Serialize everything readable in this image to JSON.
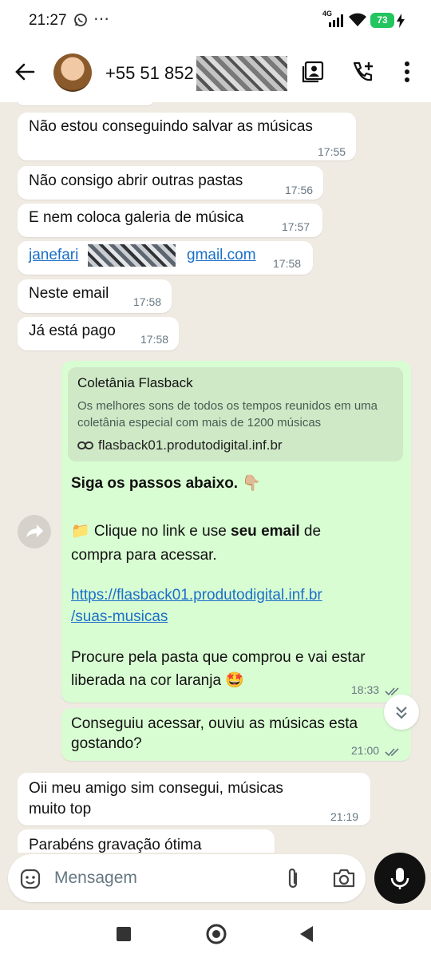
{
  "status_bar": {
    "time": "21:27",
    "dots": "⋯",
    "network": "4G",
    "battery": "73"
  },
  "header": {
    "contact_name": "+55 51 852"
  },
  "messages": [
    {
      "text": "Não estou conseguindo salvar as músicas",
      "time": "17:55"
    },
    {
      "text": "Não consigo abrir outras pastas",
      "time": "17:56"
    },
    {
      "text": "E nem coloca galeria de música",
      "time": "17:57"
    },
    {
      "email_start": "janefari",
      "email_end": "gmail.com",
      "time": "17:58"
    },
    {
      "text": "Neste email",
      "time": "17:58"
    },
    {
      "text": "Já está pago",
      "time": "17:58"
    }
  ],
  "forwarded": {
    "preview_title": "Coletânia Flasback",
    "preview_desc": "Os melhores sons de todos os tempos reunidos em uma coletânia especial com mais de 1200 músicas",
    "preview_url": "flasback01.produtodigital.inf.br",
    "line1": "Siga os passos abaixo. 👇🏼",
    "line2_pre": "📁 Clique no link e use ",
    "line2_bold": "seu email",
    "line2_post": " de",
    "line3": "compra para acessar.",
    "link_line1": "https://flasback01.produtodigital.inf.br",
    "link_line2": "/suas-musicas",
    "line4": "Procure pela pasta que comprou e vai estar",
    "line5": "liberada na cor laranja 🤩",
    "time": "18:33"
  },
  "sent2": {
    "line1": "Conseguiu acessar, ouviu as músicas esta",
    "line2": "gostando?",
    "time": "21:00"
  },
  "reply": {
    "line1": "Oii meu amigo sim consegui, músicas",
    "line2": "muito top",
    "time": "21:19"
  },
  "partial": {
    "text": "Parabéns gravação ótima"
  },
  "composer": {
    "placeholder": "Mensagem"
  },
  "colors": {
    "outgoing": "#d9fdd3",
    "incoming": "#ffffff",
    "link": "#1a6fc9",
    "background": "#efeae2"
  }
}
